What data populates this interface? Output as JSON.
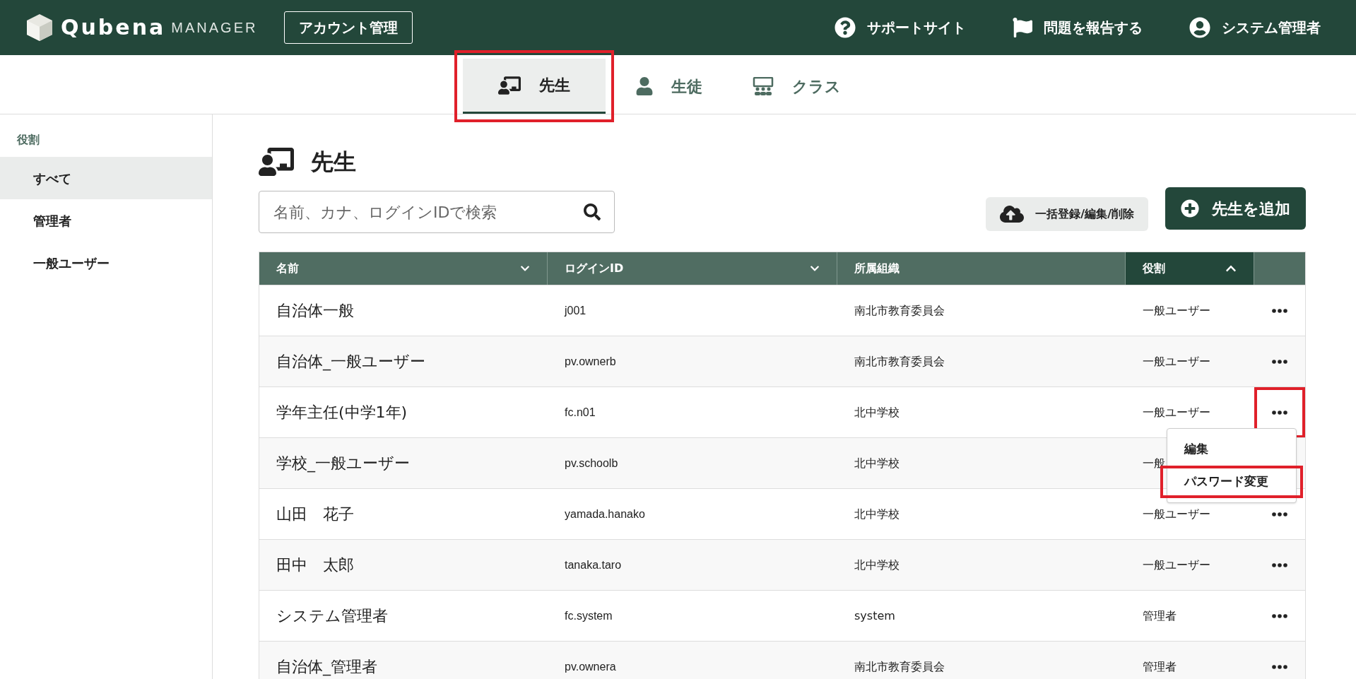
{
  "header": {
    "logo_text": "Qubena",
    "logo_sub": "MANAGER",
    "section_button": "アカウント管理",
    "links": [
      {
        "kind": "help",
        "label": "サポートサイト"
      },
      {
        "kind": "flag",
        "label": "問題を報告する"
      },
      {
        "kind": "user",
        "label": "システム管理者"
      }
    ]
  },
  "tabs": [
    {
      "kind": "teacher",
      "label": "先生",
      "selected": true,
      "highlighted": true
    },
    {
      "kind": "student",
      "label": "生徒",
      "selected": false,
      "highlighted": false
    },
    {
      "kind": "class",
      "label": "クラス",
      "selected": false,
      "highlighted": false
    }
  ],
  "sidebar": {
    "heading": "役割",
    "items": [
      {
        "label": "すべて",
        "selected": true
      },
      {
        "label": "管理者",
        "selected": false
      },
      {
        "label": "一般ユーザー",
        "selected": false
      }
    ]
  },
  "page_title": "先生",
  "search": {
    "placeholder": "名前、カナ、ログインIDで検索"
  },
  "bulk_button": "一括登録/編集/削除",
  "add_button": "先生を追加",
  "table": {
    "columns": [
      {
        "label": "名前",
        "sortable": true,
        "sorted_up": false,
        "selected": false
      },
      {
        "label": "ログインID",
        "sortable": true,
        "sorted_up": false,
        "selected": false
      },
      {
        "label": "所属組織",
        "sortable": false,
        "selected": false
      },
      {
        "label": "役割",
        "sortable": true,
        "sorted_up": true,
        "selected": true
      }
    ],
    "rows": [
      {
        "name": "自治体一般",
        "login_id": "j001",
        "org": "南北市教育委員会",
        "role": "一般ユーザー",
        "menu_open": false,
        "highlighted": false
      },
      {
        "name": "自治体_一般ユーザー",
        "login_id": "pv.ownerb",
        "org": "南北市教育委員会",
        "role": "一般ユーザー",
        "menu_open": false,
        "highlighted": false
      },
      {
        "name": "学年主任(中学1年)",
        "login_id": "fc.n01",
        "org": "北中学校",
        "role": "一般ユーザー",
        "menu_open": true,
        "highlighted": true
      },
      {
        "name": "学校_一般ユーザー",
        "login_id": "pv.schoolb",
        "org": "北中学校",
        "role": "一般",
        "menu_open": false,
        "highlighted": false
      },
      {
        "name": "山田　花子",
        "login_id": "yamada.hanako",
        "org": "北中学校",
        "role": "一般ユーザー",
        "menu_open": false,
        "highlighted": false
      },
      {
        "name": "田中　太郎",
        "login_id": "tanaka.taro",
        "org": "北中学校",
        "role": "一般ユーザー",
        "menu_open": false,
        "highlighted": false
      },
      {
        "name": "システム管理者",
        "login_id": "fc.system",
        "org": "system",
        "role": "管理者",
        "menu_open": false,
        "highlighted": false
      },
      {
        "name": "自治体_管理者",
        "login_id": "pv.ownera",
        "org": "南北市教育委員会",
        "role": "管理者",
        "menu_open": false,
        "highlighted": false
      }
    ]
  },
  "row_menu": {
    "items": [
      {
        "label": "編集",
        "highlighted": false
      },
      {
        "label": "パスワード変更",
        "highlighted": true
      }
    ]
  }
}
